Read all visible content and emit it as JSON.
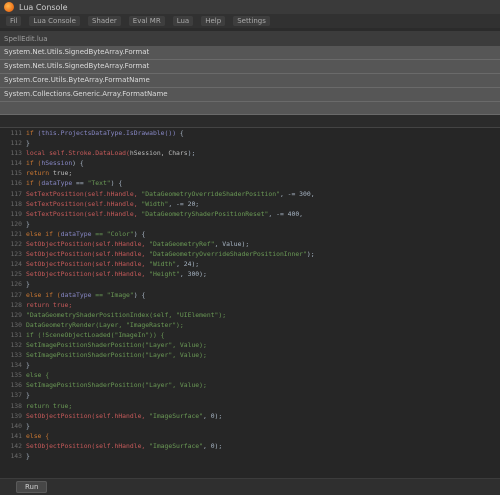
{
  "window": {
    "title": "Lua Console"
  },
  "menu": {
    "items": [
      "Fil",
      "Lua Console",
      "Shader",
      "Eval MR",
      "Lua",
      "Help",
      "Settings"
    ]
  },
  "search": {
    "label": "SpellEdit.lua",
    "results": [
      "System.Net.Utils.SignedByteArray.Format",
      "System.Net.Utils.SignedByteArray.Format",
      "System.Core.Utils.ByteArray.FormatName",
      "System.Collections.Generic.Array.FormatName",
      ""
    ]
  },
  "editor": {
    "lines": [
      {
        "n": "111",
        "tokens": [
          {
            "t": "  if ",
            "c": "kw"
          },
          {
            "t": "(this.ProjectsDataType.IsDrawable())",
            "c": "ty"
          },
          {
            "t": " {",
            "c": "op"
          }
        ]
      },
      {
        "n": "112",
        "tokens": [
          {
            "t": "  }",
            "c": "op"
          }
        ]
      },
      {
        "n": "113",
        "tokens": [
          {
            "t": "  local self.Stroke.DataLoad(",
            "c": "fn"
          },
          {
            "t": "hSession, Chars",
            "c": "code"
          },
          {
            "t": ");",
            "c": "op"
          }
        ]
      },
      {
        "n": "114",
        "tokens": [
          {
            "t": "  if (",
            "c": "kw"
          },
          {
            "t": "hSession",
            "c": "ty"
          },
          {
            "t": ") {",
            "c": "op"
          }
        ]
      },
      {
        "n": "115",
        "tokens": [
          {
            "t": "    return",
            "c": "kw"
          },
          {
            "t": " true;",
            "c": "code"
          }
        ]
      },
      {
        "n": "116",
        "tokens": [
          {
            "t": "    if (",
            "c": "kw"
          },
          {
            "t": "dataType",
            "c": "ty"
          },
          {
            "t": " == ",
            "c": "op"
          },
          {
            "t": "\"Text\"",
            "c": "str"
          },
          {
            "t": ") {",
            "c": "op"
          }
        ]
      },
      {
        "n": "117",
        "tokens": [
          {
            "t": "      SetTextPosition(self.hHandle,",
            "c": "fn"
          },
          {
            "t": " \"DataGeometryOverrideShaderPosition\"",
            "c": "str"
          },
          {
            "t": ", -= 300,",
            "c": "op"
          }
        ]
      },
      {
        "n": "118",
        "tokens": [
          {
            "t": "      SetTextPosition(self.hHandle,",
            "c": "fn"
          },
          {
            "t": " \"Width\"",
            "c": "str"
          },
          {
            "t": ", -= 20;",
            "c": "op"
          }
        ]
      },
      {
        "n": "119",
        "tokens": [
          {
            "t": "      SetTextPosition(self.hHandle,",
            "c": "fn"
          },
          {
            "t": " \"DataGeometryShaderPositionReset\"",
            "c": "str"
          },
          {
            "t": ", -= 400,",
            "c": "op"
          }
        ]
      },
      {
        "n": "120",
        "tokens": [
          {
            "t": "  }",
            "c": "op"
          }
        ]
      },
      {
        "n": "121",
        "tokens": [
          {
            "t": "    else if (",
            "c": "kw"
          },
          {
            "t": "dataType",
            "c": "ty"
          },
          {
            "t": " == \"Color\"",
            "c": "str"
          },
          {
            "t": ") {",
            "c": "op"
          }
        ]
      },
      {
        "n": "122",
        "tokens": [
          {
            "t": "      SetObjectPosition(self.hHandle,",
            "c": "fn"
          },
          {
            "t": " \"DataGeometryRef\"",
            "c": "str"
          },
          {
            "t": ", Value);",
            "c": "op"
          }
        ]
      },
      {
        "n": "123",
        "tokens": [
          {
            "t": "      SetObjectPosition(self.hHandle,",
            "c": "fn"
          },
          {
            "t": " \"DataGeometryOverrideShaderPositionInner\"",
            "c": "str"
          },
          {
            "t": ");",
            "c": "op"
          }
        ]
      },
      {
        "n": "124",
        "tokens": [
          {
            "t": "      SetObjectPosition(self.hHandle,",
            "c": "fn"
          },
          {
            "t": " \"Width\"",
            "c": "str"
          },
          {
            "t": ", 24);",
            "c": "op"
          }
        ]
      },
      {
        "n": "125",
        "tokens": [
          {
            "t": "      SetObjectPosition(self.hHandle,",
            "c": "fn"
          },
          {
            "t": " \"Height\"",
            "c": "str"
          },
          {
            "t": ", 300);",
            "c": "op"
          }
        ]
      },
      {
        "n": "126",
        "tokens": [
          {
            "t": "  }",
            "c": "op"
          }
        ]
      },
      {
        "n": "127",
        "tokens": [
          {
            "t": "    else if (",
            "c": "kw"
          },
          {
            "t": "dataType",
            "c": "ty"
          },
          {
            "t": " == \"Image\"",
            "c": "str"
          },
          {
            "t": ") {",
            "c": "op"
          }
        ]
      },
      {
        "n": "128",
        "tokens": [
          {
            "t": "      return true;",
            "c": "fn"
          }
        ]
      },
      {
        "n": "129",
        "tokens": [
          {
            "t": "      \"DataGeometryShaderPositionIndex(self, \"UIElement\");",
            "c": "str"
          }
        ]
      },
      {
        "n": "130",
        "tokens": [
          {
            "t": "      DataGeometryRender(Layer, \"ImageRaster\");",
            "c": "str"
          }
        ]
      },
      {
        "n": "131",
        "tokens": [
          {
            "t": "      if (!SceneObjectLoaded(\"ImageIn\")) {",
            "c": "str"
          }
        ]
      },
      {
        "n": "132",
        "tokens": [
          {
            "t": "        SetImagePositionShaderPosition(\"Layer\", Value);",
            "c": "str"
          }
        ]
      },
      {
        "n": "133",
        "tokens": [
          {
            "t": "        SetImagePositionShaderPosition(\"Layer\", Value);",
            "c": "str"
          }
        ]
      },
      {
        "n": "134",
        "tokens": [
          {
            "t": "      }",
            "c": "op"
          }
        ]
      },
      {
        "n": "135",
        "tokens": [
          {
            "t": "      else {",
            "c": "str"
          }
        ]
      },
      {
        "n": "136",
        "tokens": [
          {
            "t": "        SetImagePositionShaderPosition(\"Layer\", Value);",
            "c": "str"
          }
        ]
      },
      {
        "n": "137",
        "tokens": [
          {
            "t": "      }",
            "c": "op"
          }
        ]
      },
      {
        "n": "138",
        "tokens": [
          {
            "t": "      return true;",
            "c": "str"
          }
        ]
      },
      {
        "n": "139",
        "tokens": [
          {
            "t": "      SetObjectPosition(self.hHandle,",
            "c": "fn"
          },
          {
            "t": " \"ImageSurface\"",
            "c": "str"
          },
          {
            "t": ", 0);",
            "c": "op"
          }
        ]
      },
      {
        "n": "140",
        "tokens": [
          {
            "t": "    }",
            "c": "op"
          }
        ]
      },
      {
        "n": "141",
        "tokens": [
          {
            "t": "    else {",
            "c": "kw"
          },
          {
            "t": "",
            "c": "op"
          }
        ]
      },
      {
        "n": "142",
        "tokens": [
          {
            "t": "      SetObjectPosition(self.hHandle,",
            "c": "fn"
          },
          {
            "t": " \"ImageSurface\"",
            "c": "str"
          },
          {
            "t": ", 0);",
            "c": "op"
          }
        ]
      },
      {
        "n": "143",
        "tokens": [
          {
            "t": "    }",
            "c": "op"
          }
        ]
      }
    ]
  },
  "status": {
    "button": "Run"
  }
}
